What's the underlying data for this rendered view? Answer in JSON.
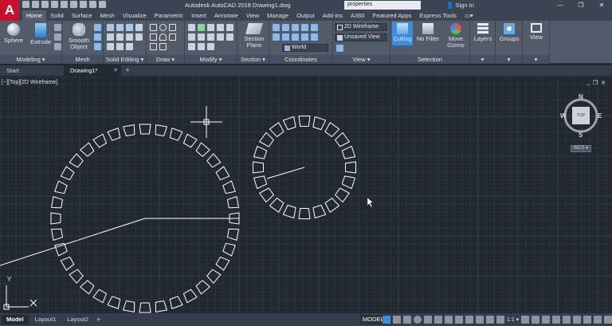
{
  "app": {
    "logo_letter": "A",
    "title": "Autodesk AutoCAD 2018   Drawing1.dwg",
    "search_value": "properties",
    "signin_label": "Sign In",
    "window_controls": [
      "—",
      "❐",
      "✕"
    ]
  },
  "ribbon_tabs": [
    "Home",
    "Solid",
    "Surface",
    "Mesh",
    "Visualize",
    "Parametric",
    "Insert",
    "Annotate",
    "View",
    "Manage",
    "Output",
    "Add-ins",
    "A360",
    "Featured Apps",
    "Express Tools",
    "▭▾"
  ],
  "ribbon": {
    "modeling": {
      "title": "Modeling ▾",
      "sphere": "Sphere",
      "extrude": "Extrude"
    },
    "mesh": {
      "title": "Mesh",
      "smooth_object_1": "Smooth",
      "smooth_object_2": "Object"
    },
    "solid_editing": {
      "title": "Solid Editing ▾"
    },
    "draw": {
      "title": "Draw ▾"
    },
    "modify": {
      "title": "Modify ▾"
    },
    "section": {
      "title": "Section ▾",
      "section_plane_1": "Section",
      "section_plane_2": "Plane"
    },
    "coordinates": {
      "title": "Coordinates",
      "ucs_value": "World"
    },
    "view": {
      "title": "View ▾",
      "visual_style": "2D Wireframe",
      "named_view": "Unsaved View"
    },
    "selection": {
      "title": "Selection",
      "culling": "Culling",
      "no_filter": "No Filter",
      "move_gizmo_1": "Move",
      "move_gizmo_2": "Gizmo"
    },
    "layers": "Layers",
    "groups": "Groups",
    "view_panel": "View"
  },
  "file_tabs": {
    "start": "Start",
    "drawing": "Drawing1*",
    "close": "✕",
    "new": "+"
  },
  "viewport": {
    "label": "[−][Top][2D Wireframe]",
    "controls": [
      "_",
      "❐",
      "✕"
    ],
    "compass": {
      "n": "N",
      "s": "S",
      "e": "E",
      "w": "W",
      "top": "TOP",
      "wcs": "WCS ▾"
    },
    "ucs": {
      "x": "X",
      "y": "Y"
    }
  },
  "status": {
    "layouts": [
      "Model",
      "Layout1",
      "Layout2"
    ],
    "add_layout": "+",
    "model": "MODEL",
    "scale": "1:1 ▾"
  },
  "colors": {
    "canvas": "#212830",
    "grid_minor": "#2a323d",
    "grid_major": "#343d4a",
    "geometry": "#ffffff",
    "accent_red": "#c8102e",
    "active_blue": "#3d8edb"
  },
  "drawing": {
    "large_gear_teeth": 36,
    "small_gear_teeth": 20
  }
}
